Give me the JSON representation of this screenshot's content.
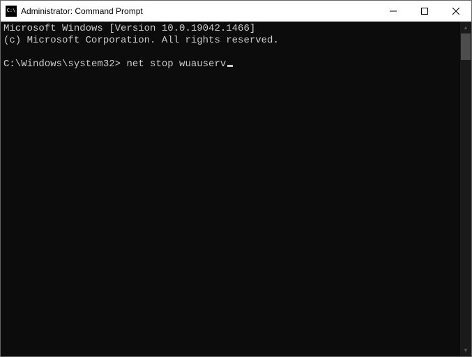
{
  "titlebar": {
    "title": "Administrator: Command Prompt"
  },
  "terminal": {
    "line1": "Microsoft Windows [Version 10.0.19042.1466]",
    "line2": "(c) Microsoft Corporation. All rights reserved.",
    "blank": "",
    "prompt": "C:\\Windows\\system32>",
    "command": "net stop wuauserv"
  }
}
